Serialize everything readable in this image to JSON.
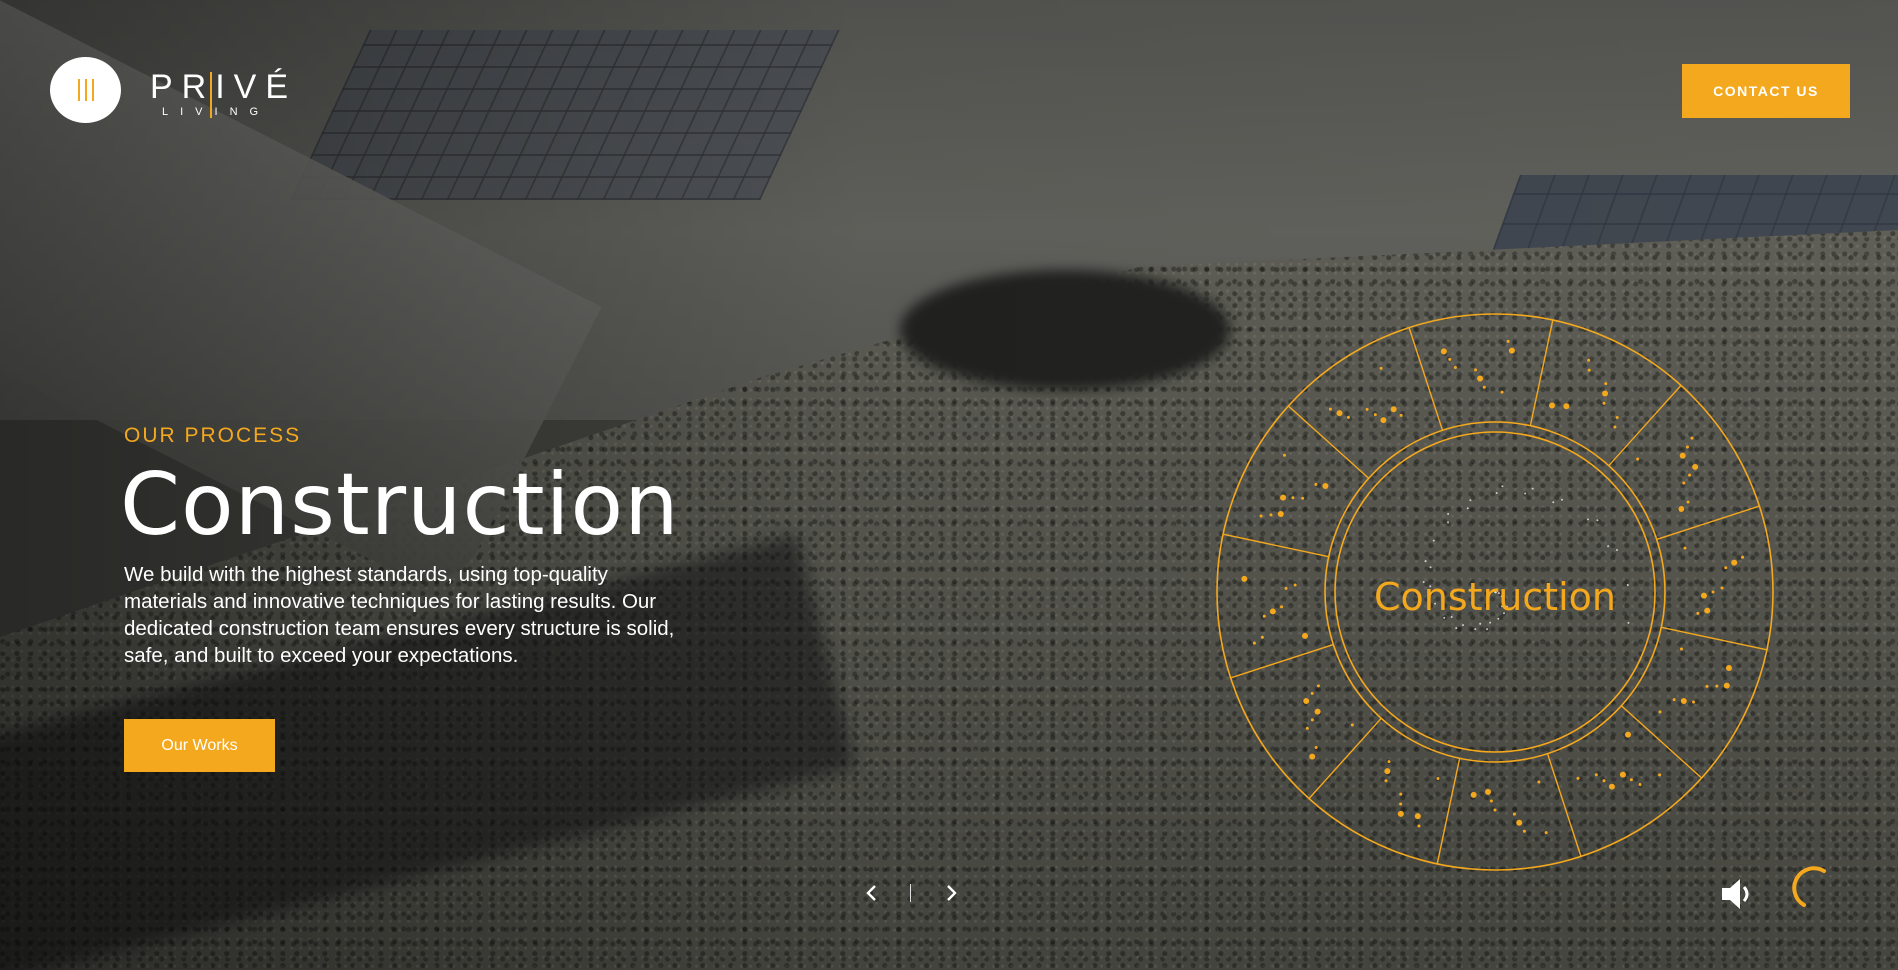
{
  "brand": {
    "name": "PRIVÉ",
    "tagline": "LIVING",
    "accent_color": "#f4a81d"
  },
  "header": {
    "menu_icon": "hamburger-bars-icon",
    "contact_label": "CONTACT US"
  },
  "hero": {
    "eyebrow": "OUR PROCESS",
    "title": "Construction",
    "description": "We build with the highest standards, using top-quality materials and innovative techniques for lasting results. Our dedicated construction team ensures every structure is solid, safe, and built to exceed your expectations.",
    "cta_label": "Our Works"
  },
  "wheel": {
    "center_label": "Construction",
    "segment_count": 12
  },
  "controls": {
    "prev_icon": "chevron-left-icon",
    "next_icon": "chevron-right-icon",
    "sound_icon": "speaker-icon",
    "loader_icon": "loading-spinner-icon"
  }
}
